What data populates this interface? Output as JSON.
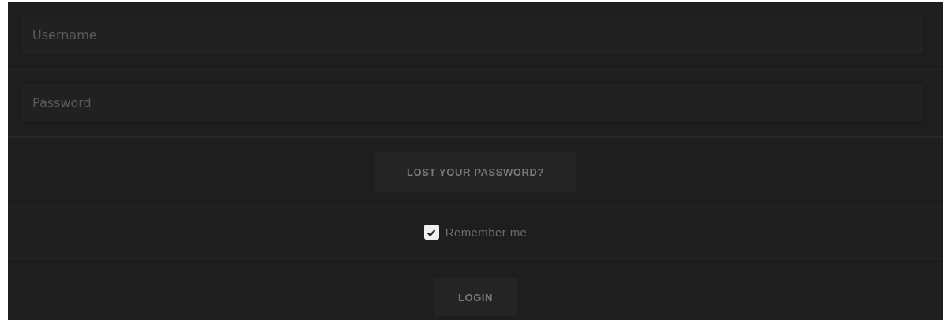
{
  "fields": [
    {
      "placeholder": "Username"
    },
    {
      "placeholder": "Password"
    }
  ],
  "lost_password": {
    "label": "LOST YOUR PASSWORD?"
  },
  "remember": {
    "label": "Remember me",
    "checked": true
  },
  "login": {
    "label": "LOGIN"
  }
}
